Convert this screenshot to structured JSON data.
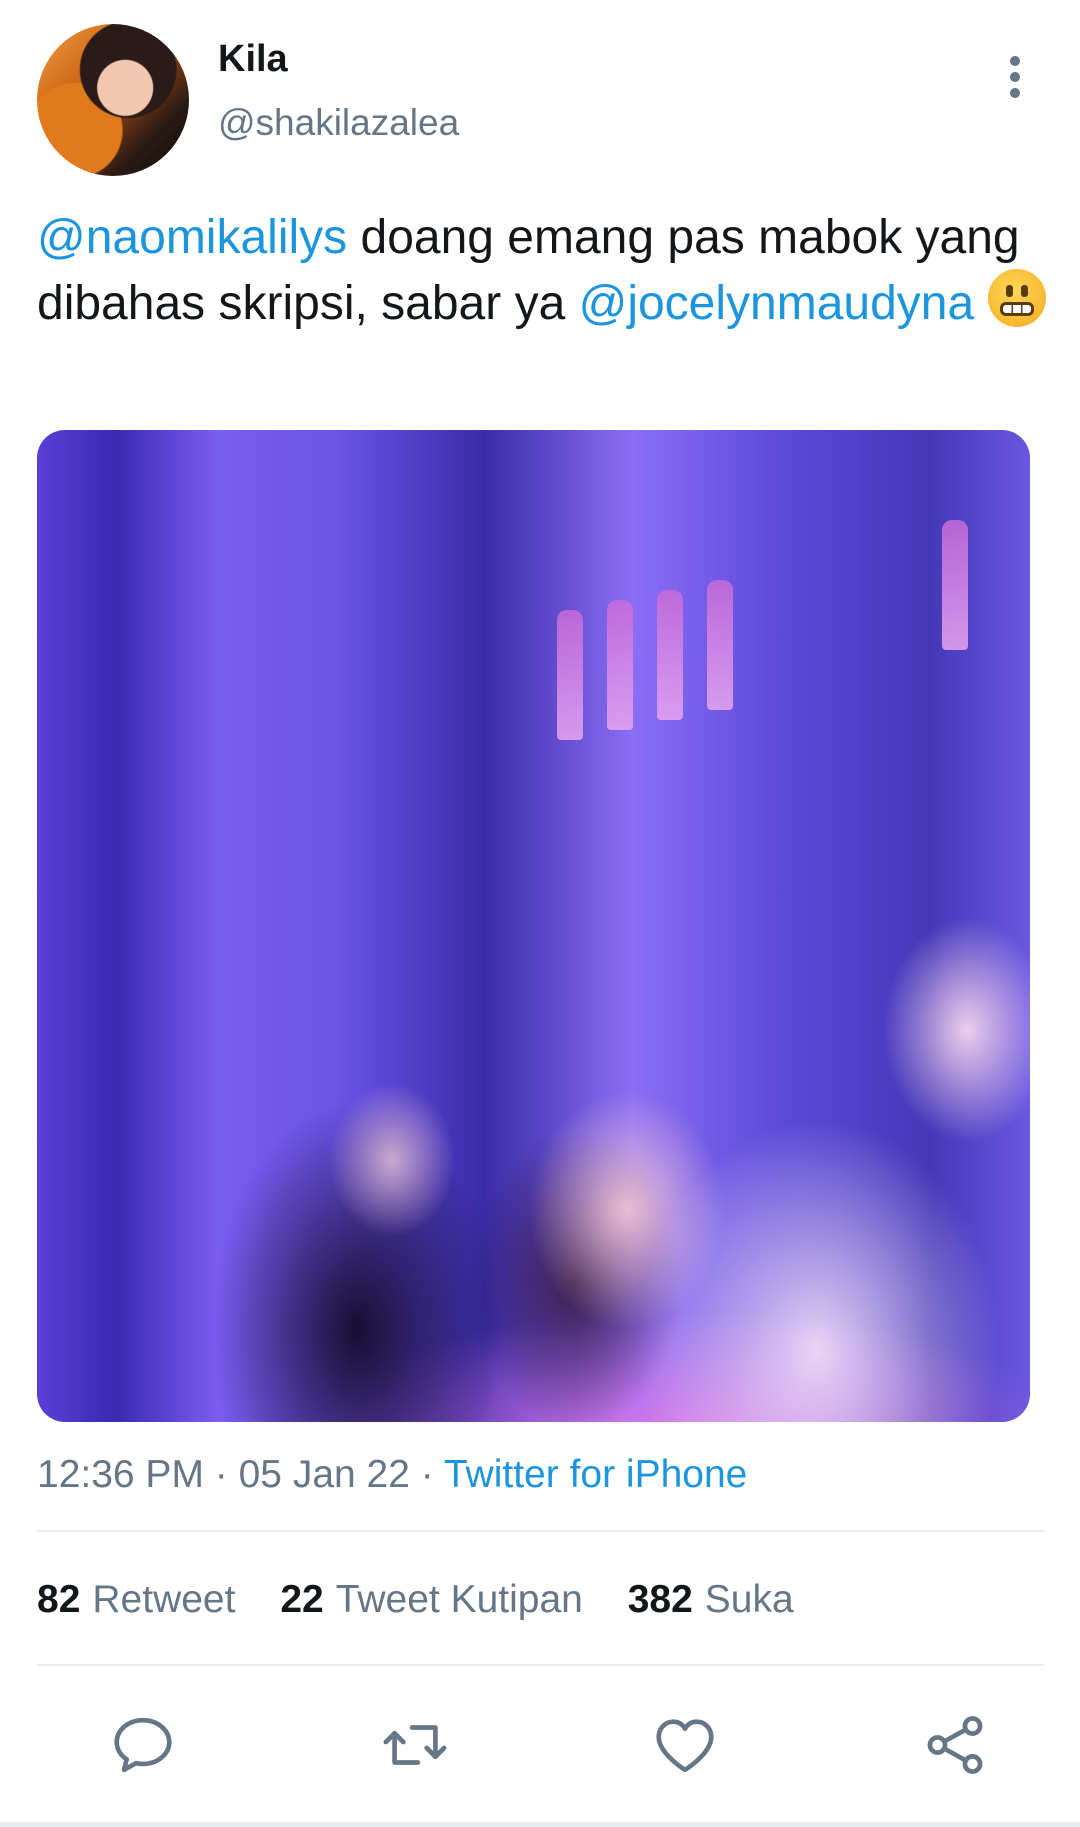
{
  "author": {
    "name": "Kila",
    "handle": "@shakilazalea"
  },
  "tweet": {
    "mention_1": "@naomikalilys",
    "text_1": " doang emang pas mabok yang dibahas skripsi, sabar ya ",
    "mention_2": "@jocelynmaudyna",
    "emoji": "grimacing-face"
  },
  "meta": {
    "time": "12:36 PM",
    "sep_1": " · ",
    "date": "05 Jan 22",
    "sep_2": " · ",
    "source": "Twitter for iPhone"
  },
  "stats": {
    "retweets_count": "82",
    "retweets_label": "Retweet",
    "quotes_count": "22",
    "quotes_label": "Tweet Kutipan",
    "likes_count": "382",
    "likes_label": "Suka"
  },
  "actions": [
    "reply-icon",
    "retweet-icon",
    "like-icon",
    "share-icon"
  ],
  "colors": {
    "link": "#1b95e0",
    "muted": "#657786",
    "text": "#14171a"
  }
}
